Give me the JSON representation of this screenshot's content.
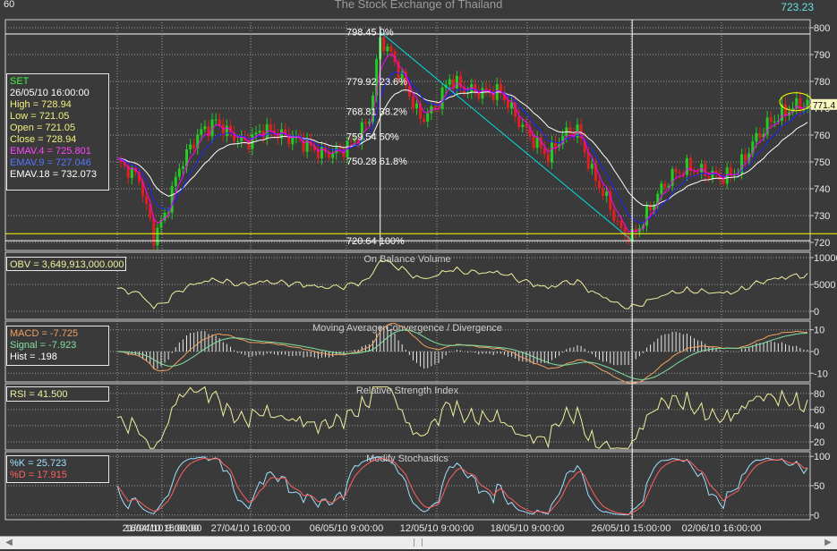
{
  "header": {
    "interval": "60",
    "title": "The Stock Exchange of Thailand",
    "last_price": "723.23"
  },
  "colors": {
    "background": "#3a3a3a",
    "up_candle": "#22cc22",
    "down_candle": "#e02020",
    "ema4": "#ff00ff",
    "ema9": "#2222ff",
    "ema18": "#ffffff",
    "fib_line": "#00e0e0",
    "obv": "#f0f0a0",
    "macd": "#f0a060",
    "signal": "#80e0a0",
    "hist": "#e8e8e8",
    "rsi": "#f0f0a0",
    "k": "#a0e0ff",
    "d": "#ff6060"
  },
  "info_boxes": {
    "set": [
      {
        "text": "SET",
        "color": "#44ee44"
      },
      {
        "text": "26/05/10 16:00:00",
        "color": "#ffffff"
      },
      {
        "text": "High  = 728.94",
        "color": "#f0f080"
      },
      {
        "text": "Low  = 721.05",
        "color": "#f0f080"
      },
      {
        "text": "Open = 721.05",
        "color": "#f0f080"
      },
      {
        "text": "Close = 728.94",
        "color": "#f0f080"
      },
      {
        "text": "EMAV.4 = 725.801",
        "color": "#ff44ff"
      },
      {
        "text": "EMAV.9 = 727.046",
        "color": "#5577ff"
      },
      {
        "text": "EMAV.18 = 732.073",
        "color": "#ffffff"
      }
    ],
    "obv": "OBV = 3,649,913,000.000",
    "macd": [
      {
        "text": "MACD = -7.725",
        "color": "#f0a060"
      },
      {
        "text": "Signal = -7.923",
        "color": "#80e0a0"
      },
      {
        "text": "Hist = .198",
        "color": "#ffffff"
      }
    ],
    "rsi": "RSI = 41.500",
    "stoch": [
      {
        "text": "%K = 25.723",
        "color": "#a0e0ff"
      },
      {
        "text": "%D = 17.915",
        "color": "#ff6060"
      }
    ]
  },
  "scrollbar": {
    "left_arrow": "◀",
    "right_arrow": "▶"
  },
  "chart_data": {
    "type": "candlestick",
    "x_tick_labels": [
      "16/04/10 9:00:00",
      "21/04/10 15:00:00",
      "27/04/10 16:00:00",
      "06/05/10 9:00:00",
      "12/05/10 9:00:00",
      "18/05/10 9:00:00",
      "26/05/10 15:00:00",
      "02/06/10 16:00:00"
    ],
    "price_panel": {
      "y_ticks": [
        720,
        730,
        740,
        750,
        760,
        770,
        780,
        790,
        800
      ],
      "ylim": [
        717,
        803
      ],
      "current_price_label": "771.4",
      "ohlc_anchors": [
        {
          "i": 0,
          "c": 750
        },
        {
          "i": 6,
          "c": 744
        },
        {
          "i": 10,
          "c": 722
        },
        {
          "i": 13,
          "c": 730
        },
        {
          "i": 17,
          "c": 748
        },
        {
          "i": 22,
          "c": 760
        },
        {
          "i": 27,
          "c": 765
        },
        {
          "i": 31,
          "c": 760
        },
        {
          "i": 35,
          "c": 757
        },
        {
          "i": 40,
          "c": 762
        },
        {
          "i": 45,
          "c": 760
        },
        {
          "i": 50,
          "c": 758
        },
        {
          "i": 56,
          "c": 753
        },
        {
          "i": 61,
          "c": 754
        },
        {
          "i": 65,
          "c": 758
        },
        {
          "i": 69,
          "c": 766
        },
        {
          "i": 72,
          "c": 796
        },
        {
          "i": 75,
          "c": 790
        },
        {
          "i": 79,
          "c": 778
        },
        {
          "i": 83,
          "c": 766
        },
        {
          "i": 87,
          "c": 770
        },
        {
          "i": 91,
          "c": 781
        },
        {
          "i": 95,
          "c": 777
        },
        {
          "i": 100,
          "c": 776
        },
        {
          "i": 105,
          "c": 776
        },
        {
          "i": 110,
          "c": 765
        },
        {
          "i": 114,
          "c": 758
        },
        {
          "i": 118,
          "c": 752
        },
        {
          "i": 122,
          "c": 760
        },
        {
          "i": 126,
          "c": 762
        },
        {
          "i": 130,
          "c": 746
        },
        {
          "i": 134,
          "c": 736
        },
        {
          "i": 138,
          "c": 724
        },
        {
          "i": 141,
          "c": 722
        },
        {
          "i": 144,
          "c": 728
        },
        {
          "i": 148,
          "c": 738
        },
        {
          "i": 152,
          "c": 745
        },
        {
          "i": 156,
          "c": 748
        },
        {
          "i": 161,
          "c": 746
        },
        {
          "i": 166,
          "c": 744
        },
        {
          "i": 170,
          "c": 747
        },
        {
          "i": 174,
          "c": 757
        },
        {
          "i": 178,
          "c": 764
        },
        {
          "i": 182,
          "c": 768
        },
        {
          "i": 186,
          "c": 771
        }
      ],
      "fibonacci": [
        {
          "price": 798.45,
          "label": "798.45 0%"
        },
        {
          "price": 779.92,
          "label": "779.92 23.6%"
        },
        {
          "price": 768.81,
          "label": "768.81 38.2%"
        },
        {
          "price": 759.54,
          "label": "759.54 50%"
        },
        {
          "price": 750.28,
          "label": "750.28 61.8%"
        },
        {
          "price": 720.64,
          "label": "720.64 100%"
        }
      ]
    },
    "obv_panel": {
      "title": "On Balance Volume",
      "y_ticks": [
        {
          "v": 0,
          "label": "0"
        },
        {
          "v": 5000,
          "label": "5000"
        },
        {
          "v": 10000,
          "label": "10000"
        }
      ],
      "ylim": [
        -1500,
        11000
      ]
    },
    "macd_panel": {
      "title": "Moving Average Convergence / Divergence",
      "y_ticks": [
        {
          "v": -10,
          "label": "-10"
        },
        {
          "v": 0,
          "label": "0"
        },
        {
          "v": 10,
          "label": "10"
        }
      ],
      "ylim": [
        -14,
        14
      ]
    },
    "rsi_panel": {
      "title": "Relative Strength Index",
      "y_ticks": [
        {
          "v": 20,
          "label": "20"
        },
        {
          "v": 40,
          "label": "40"
        },
        {
          "v": 60,
          "label": "60"
        },
        {
          "v": 80,
          "label": "80"
        }
      ],
      "ylim": [
        10,
        92
      ]
    },
    "stoch_panel": {
      "title": "Modify Stochastics",
      "y_ticks": [
        {
          "v": 0,
          "label": "0"
        },
        {
          "v": 50,
          "label": "50"
        },
        {
          "v": 100,
          "label": "100"
        }
      ],
      "ylim": [
        -8,
        108
      ]
    }
  }
}
